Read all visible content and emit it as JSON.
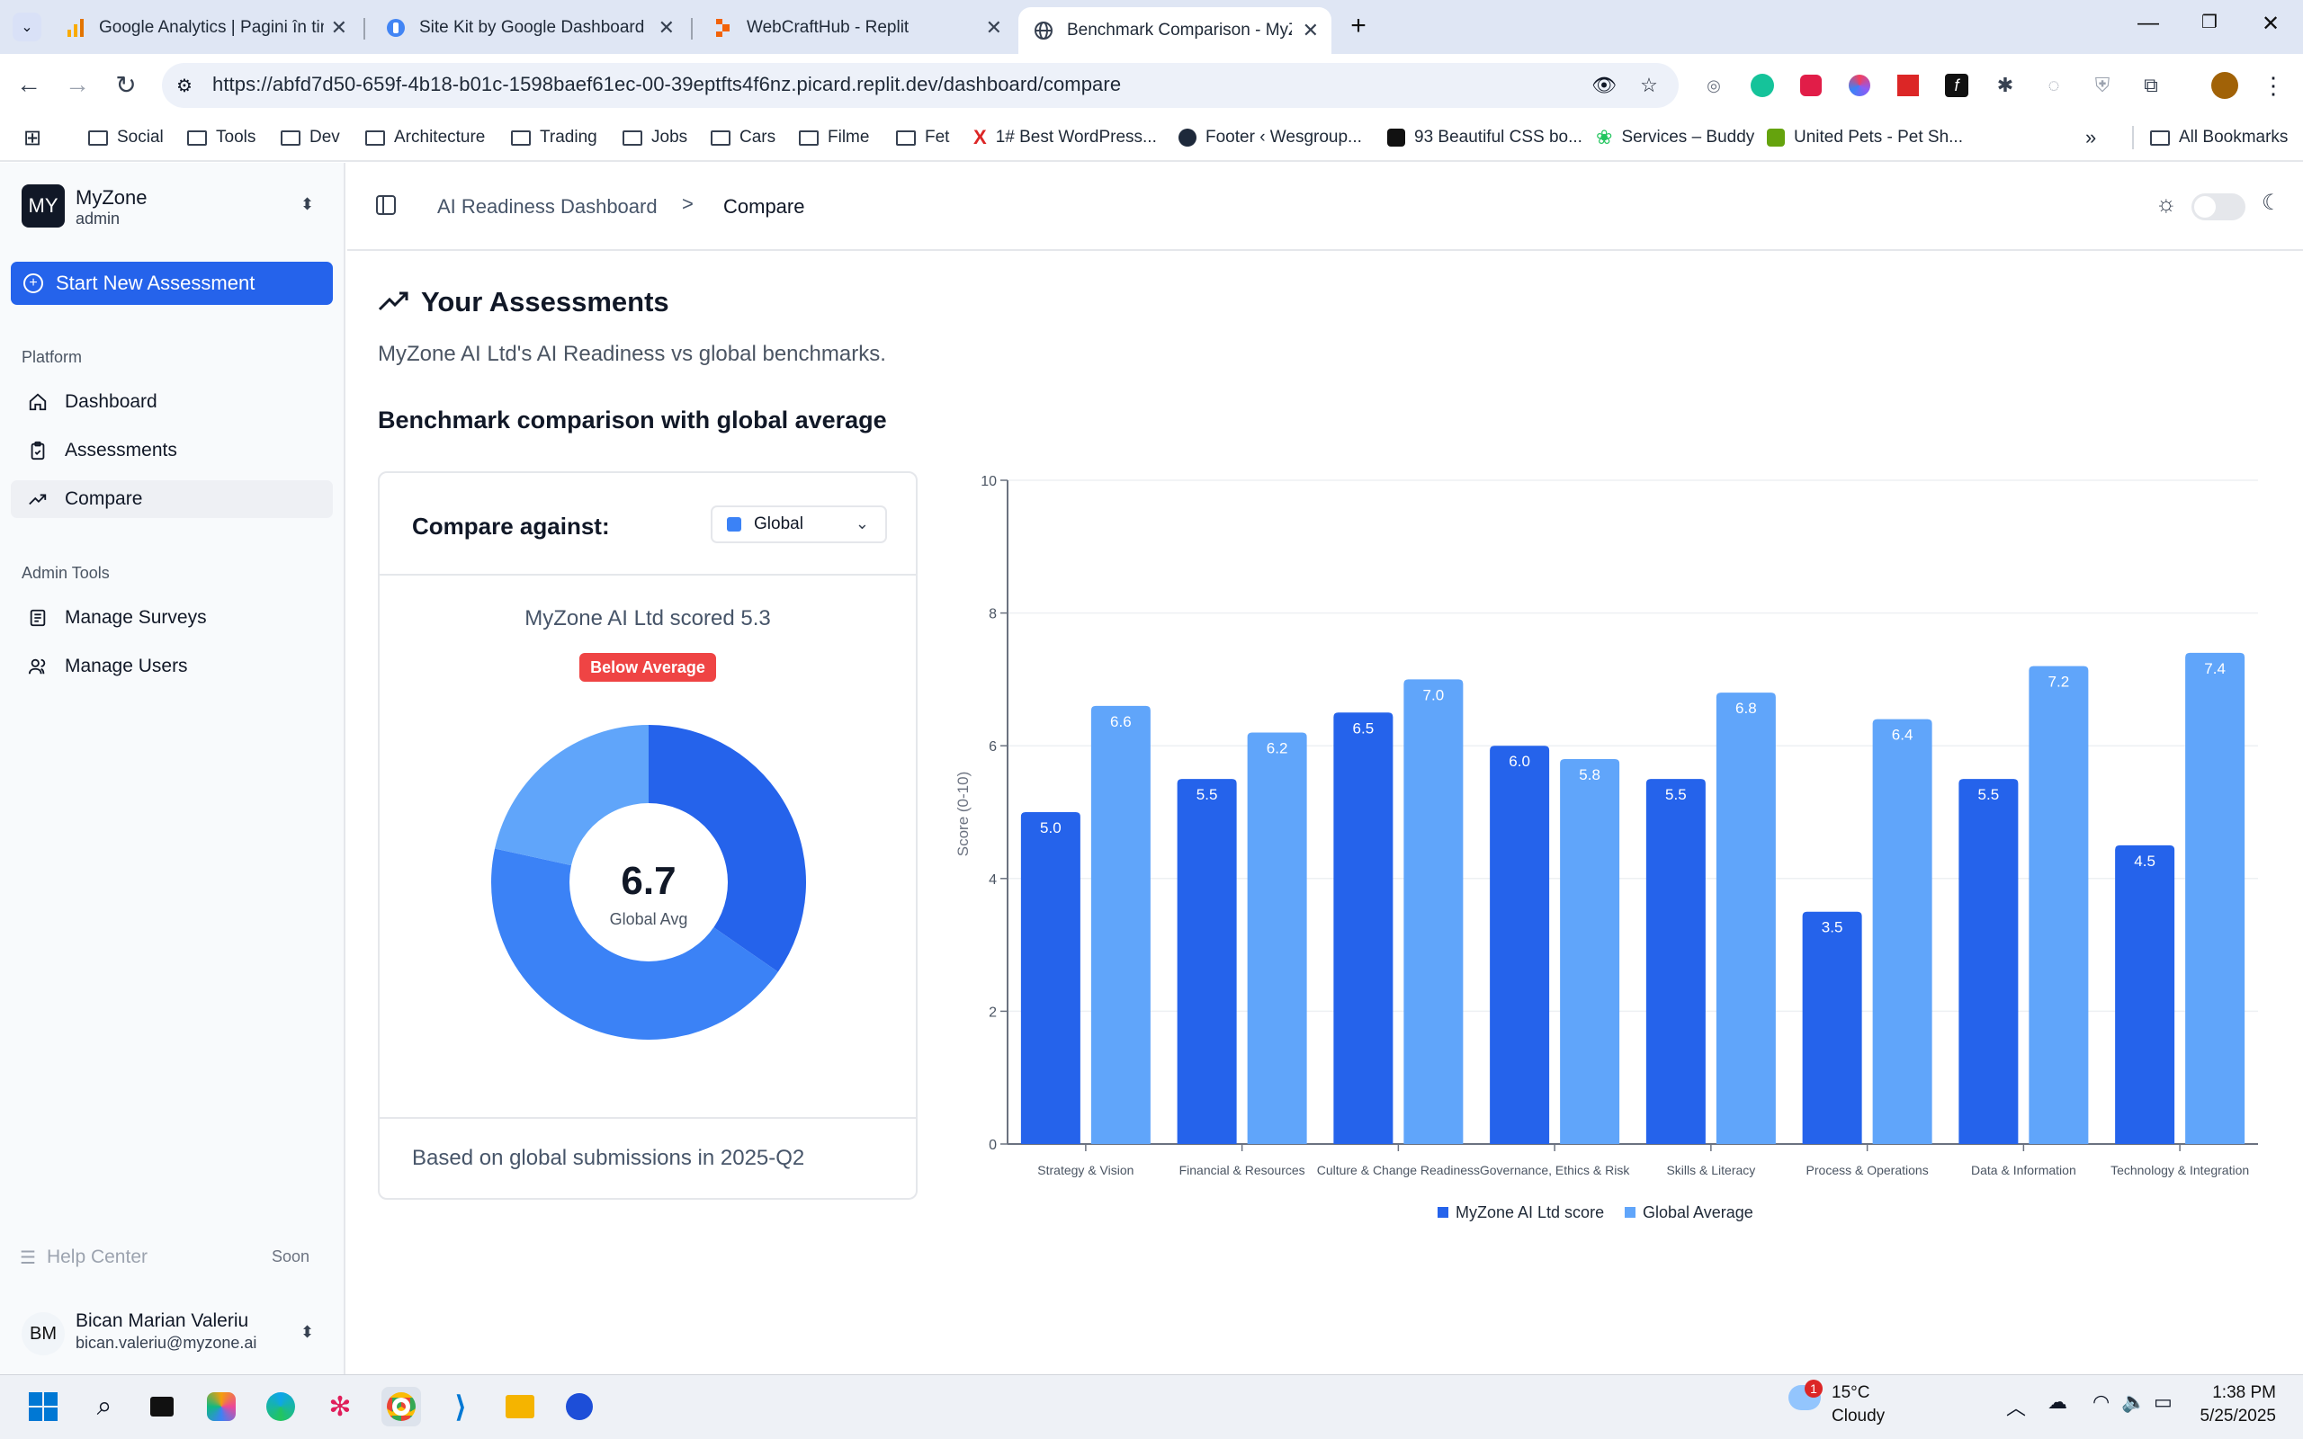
{
  "browser": {
    "tabs": [
      {
        "title": "Google Analytics | Pagini în tim",
        "icon": "analytics-icon"
      },
      {
        "title": "Site Kit by Google Dashboard ‹",
        "icon": "sitekit-icon"
      },
      {
        "title": "WebCraftHub - Replit",
        "icon": "replit-icon"
      },
      {
        "title": "Benchmark Comparison - MyZo",
        "icon": "globe-icon"
      }
    ],
    "url": "https://abfd7d50-659f-4b18-b01c-1598baef61ec-00-39eptfts4f6nz.picard.replit.dev/dashboard/compare",
    "bookmarks": [
      {
        "label": "Social",
        "type": "folder"
      },
      {
        "label": "Tools",
        "type": "folder"
      },
      {
        "label": "Dev",
        "type": "folder"
      },
      {
        "label": "Architecture",
        "type": "folder"
      },
      {
        "label": "Trading",
        "type": "folder"
      },
      {
        "label": "Jobs",
        "type": "folder"
      },
      {
        "label": "Cars",
        "type": "folder"
      },
      {
        "label": "Filme",
        "type": "folder"
      },
      {
        "label": "Fet",
        "type": "folder"
      },
      {
        "label": "1# Best WordPress...",
        "type": "site"
      },
      {
        "label": "Footer ‹ Wesgroup...",
        "type": "site"
      },
      {
        "label": "93 Beautiful CSS bo...",
        "type": "site"
      },
      {
        "label": "Services – Buddy",
        "type": "site"
      },
      {
        "label": "United Pets - Pet Sh...",
        "type": "site"
      }
    ],
    "all_bookmarks": "All Bookmarks",
    "more": "»"
  },
  "sidebar": {
    "org_initials": "MY",
    "org_name": "MyZone",
    "org_role": "admin",
    "new_assessment": "Start New Assessment",
    "platform_label": "Platform",
    "platform_items": [
      "Dashboard",
      "Assessments",
      "Compare"
    ],
    "admin_label": "Admin Tools",
    "admin_items": [
      "Manage Surveys",
      "Manage Users"
    ],
    "help": "Help Center",
    "help_badge": "Soon",
    "user_initials": "BM",
    "user_name": "Bican Marian Valeriu",
    "user_email": "bican.valeriu@myzone.ai"
  },
  "header": {
    "breadcrumb": [
      "AI Readiness Dashboard",
      "Compare"
    ],
    "separator": ">"
  },
  "page": {
    "title": "Your Assessments",
    "subtitle": "MyZone AI Ltd's AI Readiness vs global benchmarks.",
    "section_title": "Benchmark comparison with global average"
  },
  "compare_card": {
    "label": "Compare against:",
    "selected": "Global",
    "selected_color": "#3b82f6",
    "scored_text": "MyZone AI Ltd scored 5.3",
    "badge": "Below Average",
    "badge_color": "#ef4444",
    "donut_value": "6.7",
    "donut_label": "Global Avg",
    "footer": "Based on global submissions in 2025-Q2"
  },
  "donut_data": {
    "type": "pie",
    "slices": [
      {
        "name": "MyZone AI Ltd",
        "value": 5.3,
        "color": "#2563eb"
      },
      {
        "name": "Global Avg",
        "value": 6.7,
        "color": "#3b82f6"
      },
      {
        "name": "Remainder",
        "value": 3.3,
        "color": "#60a5fa"
      }
    ]
  },
  "chart_data": {
    "type": "bar",
    "categories": [
      "Strategy & Vision",
      "Financial & Resources",
      "Culture & Change Readiness",
      "Governance, Ethics & Risk",
      "Skills & Literacy",
      "Process & Operations",
      "Data & Information",
      "Technology & Integration"
    ],
    "series": [
      {
        "name": "MyZone AI Ltd score",
        "values": [
          5.0,
          5.5,
          6.5,
          6.0,
          5.5,
          3.5,
          5.5,
          4.5
        ],
        "color": "#2563eb"
      },
      {
        "name": "Global Average",
        "values": [
          6.6,
          6.2,
          7.0,
          5.8,
          6.8,
          6.4,
          7.2,
          7.4
        ],
        "color": "#60a5fa"
      }
    ],
    "ylabel": "Score (0-10)",
    "ylim": [
      0,
      10
    ],
    "yticks": [
      0,
      2,
      4,
      6,
      8,
      10
    ],
    "legend": "bottom",
    "grid": true
  },
  "taskbar": {
    "weather_temp": "15°C",
    "weather_desc": "Cloudy",
    "weather_badge": "1",
    "time": "1:38 PM",
    "date": "5/25/2025"
  }
}
